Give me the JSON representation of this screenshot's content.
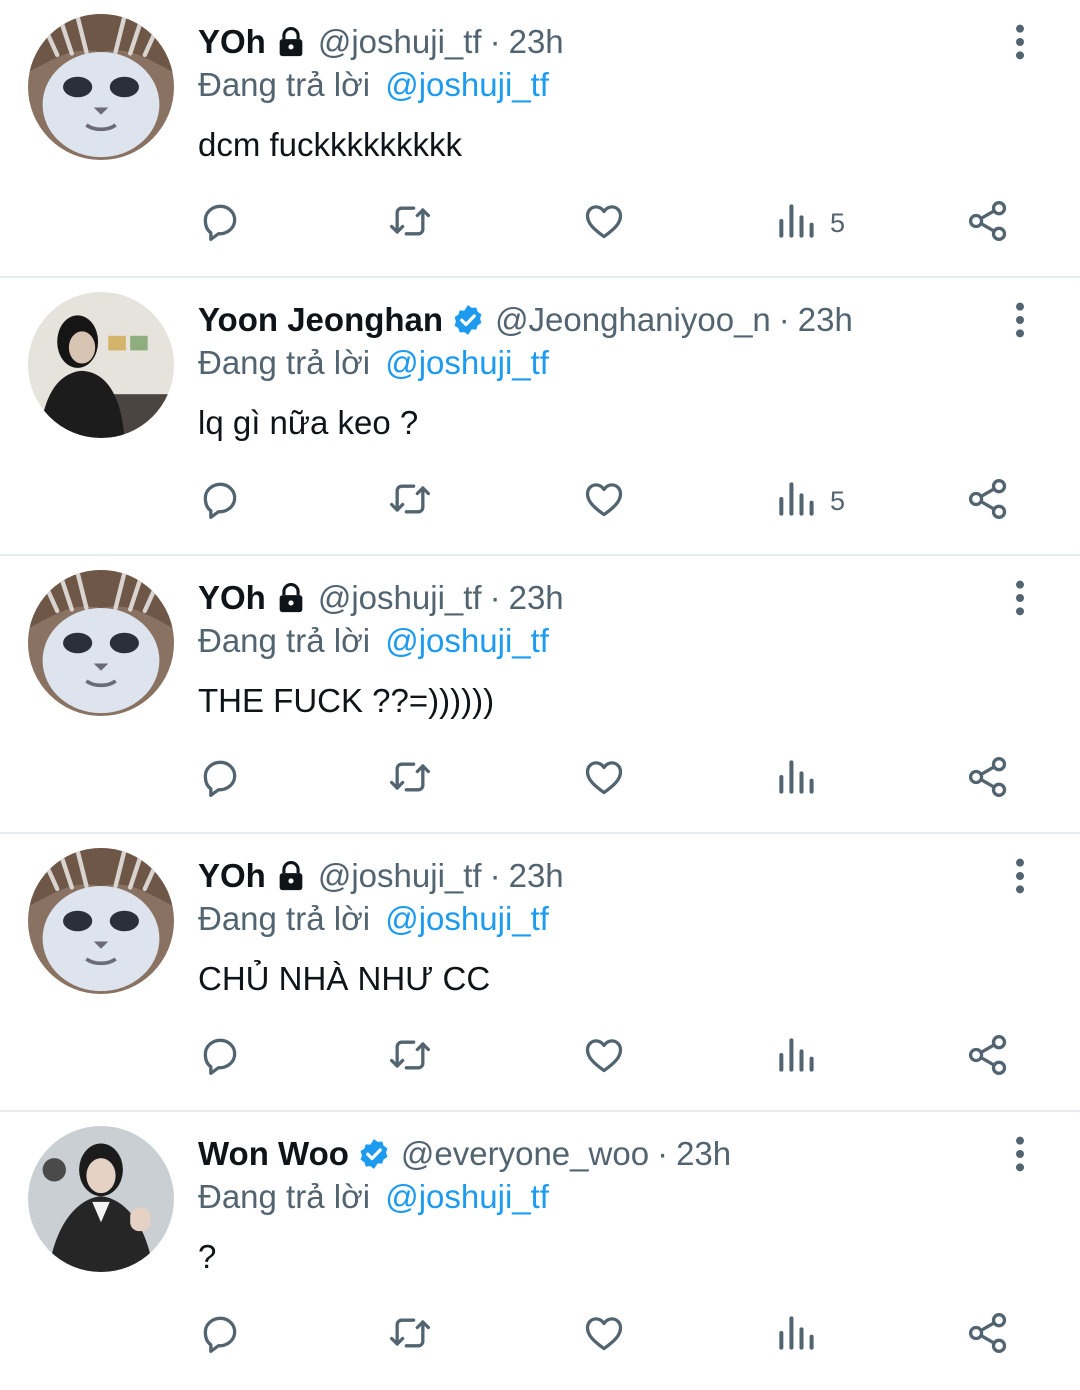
{
  "tweets": [
    {
      "name": "YOh",
      "badge": "lock-icon",
      "handle": "@joshuji_tf",
      "separator": "·",
      "time": "23h",
      "reply_prefix": "Đang trả lời",
      "reply_to": "@joshuji_tf",
      "text": "dcm fuckkkkkkkkk",
      "views": "5",
      "avatar": "cat-avatar"
    },
    {
      "name": "Yoon Jeonghan",
      "badge": "verified-icon",
      "handle": "@Jeonghaniyoo_n",
      "separator": "·",
      "time": "23h",
      "reply_prefix": "Đang trả lời",
      "reply_to": "@joshuji_tf",
      "text": "lq gì nữa keo ?",
      "views": "5",
      "avatar": "person-avatar-dark"
    },
    {
      "name": "YOh",
      "badge": "lock-icon",
      "handle": "@joshuji_tf",
      "separator": "·",
      "time": "23h",
      "reply_prefix": "Đang trả lời",
      "reply_to": "@joshuji_tf",
      "text": "THE FUCK ??=))))))",
      "views": "",
      "avatar": "cat-avatar"
    },
    {
      "name": "YOh",
      "badge": "lock-icon",
      "handle": "@joshuji_tf",
      "separator": "·",
      "time": "23h",
      "reply_prefix": "Đang trả lời",
      "reply_to": "@joshuji_tf",
      "text": "CHỦ NHÀ NHƯ CC",
      "views": "",
      "avatar": "cat-avatar"
    },
    {
      "name": "Won Woo",
      "badge": "verified-icon",
      "handle": "@everyone_woo",
      "separator": "·",
      "time": "23h",
      "reply_prefix": "Đang trả lời",
      "reply_to": "@joshuji_tf",
      "text": "?",
      "views": "",
      "avatar": "person-avatar-suit"
    }
  ],
  "colors": {
    "text": "#0f1419",
    "secondary": "#536471",
    "link": "#1d9bf0",
    "verified": "#1d9bf0",
    "divider": "#e6ecf0"
  }
}
